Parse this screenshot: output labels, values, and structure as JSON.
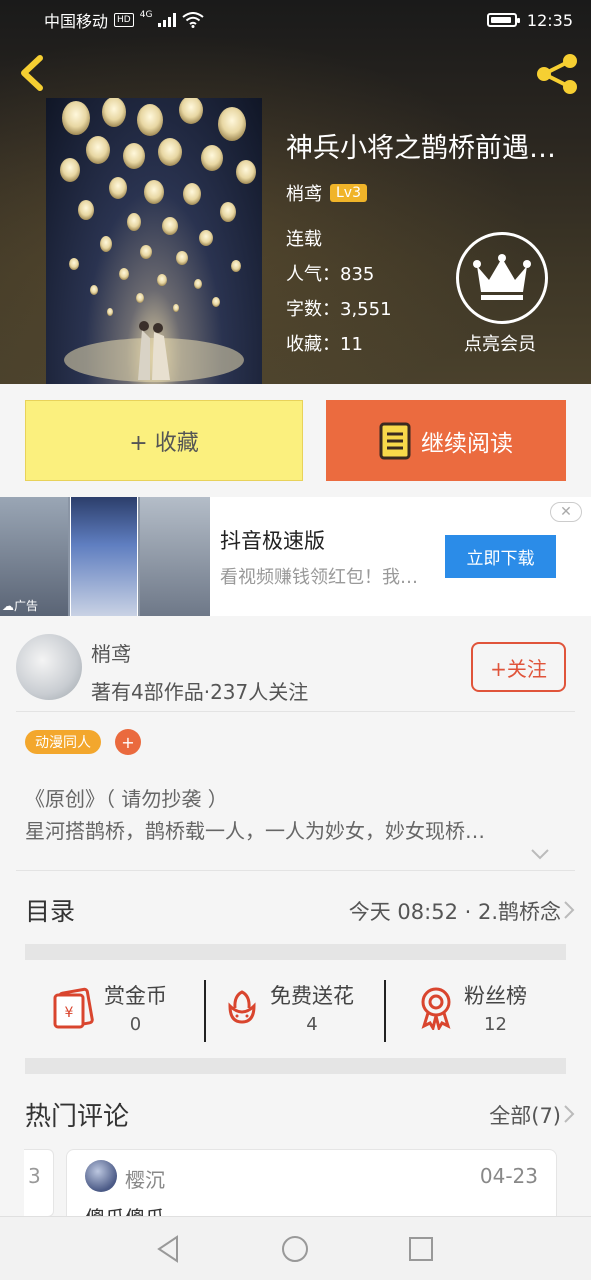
{
  "status_bar": {
    "carrier": "中国移动",
    "hd": "HD",
    "network": "4G",
    "time": "12:35"
  },
  "book": {
    "title": "神兵小将之鹊桥前遇…",
    "author": "梢鸢",
    "level": "Lv3",
    "status": "连载",
    "popularity": "人气：835",
    "word_count": "字数：3,551",
    "favorites": "收藏：11"
  },
  "vip": {
    "label": "点亮会员"
  },
  "actions": {
    "favorite_label": "+ 收藏",
    "read_label": "继续阅读"
  },
  "ad": {
    "tag": "广告",
    "title": "抖音极速版",
    "description": "看视频赚钱领红包！我…",
    "button": "立即下载"
  },
  "author_card": {
    "name": "梢鸢",
    "info": "著有4部作品·237人关注",
    "follow": "+关注"
  },
  "tags": [
    {
      "label": "动漫同人"
    }
  ],
  "tag_add": "+",
  "intro": {
    "line1": "《原创》（ 请勿抄袭 ）",
    "line2": "星河搭鹊桥，鹊桥载一人，一人为妙女，妙女现桥…"
  },
  "toc": {
    "label": "目录",
    "latest": "今天 08:52 · 2.鹊桥念"
  },
  "rewards": [
    {
      "label": "赏金币",
      "value": "0"
    },
    {
      "label": "免费送花",
      "value": "4"
    },
    {
      "label": "粉丝榜",
      "value": "12"
    }
  ],
  "comments_section": {
    "title": "热门评论",
    "all_label": "全部(7)",
    "prev_fragment": "3",
    "items": [
      {
        "user": "樱沉",
        "date": "04-23",
        "text": "傻瓜傻瓜"
      }
    ]
  },
  "colors": {
    "accent_orange": "#eb6b3f",
    "fav_yellow": "#fbf07e",
    "ad_blue": "#2b8ce8",
    "icon_red": "#d9452e",
    "lv_gold": "#f0b429"
  }
}
